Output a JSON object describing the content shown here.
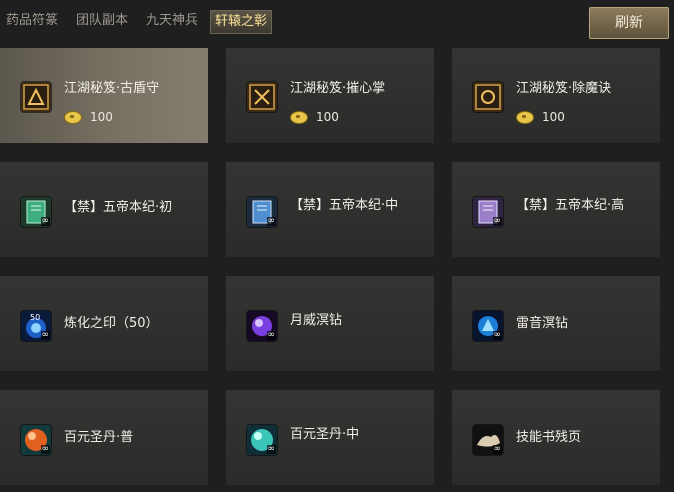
{
  "tabs": [
    {
      "label": "药品符篆",
      "active": false
    },
    {
      "label": "团队副本",
      "active": false
    },
    {
      "label": "九天神兵",
      "active": false
    },
    {
      "label": "轩辕之彰",
      "active": true
    }
  ],
  "refresh_label": "刷新",
  "currency_icon": "gold-coin-icon",
  "items": [
    {
      "name": "江湖秘笈·古盾守",
      "price": "100",
      "icon": "secret-manual-icon",
      "selected": true
    },
    {
      "name": "江湖秘笈·摧心掌",
      "price": "100",
      "icon": "secret-manual-icon",
      "selected": false
    },
    {
      "name": "江湖秘笈·除魔诀",
      "price": "100",
      "icon": "secret-manual-icon",
      "selected": false
    },
    {
      "name": "【禁】五帝本纪·初",
      "price": "",
      "icon": "green-book-icon",
      "badge": "∞",
      "selected": false
    },
    {
      "name": "【禁】五帝本纪·中",
      "price": "",
      "icon": "blue-book-icon",
      "badge": "∞",
      "selected": false
    },
    {
      "name": "【禁】五帝本纪·高",
      "price": "",
      "icon": "purple-book-icon",
      "badge": "∞",
      "selected": false
    },
    {
      "name": "炼化之印（50）",
      "price": "",
      "icon": "refine-seal-icon",
      "badge": "∞",
      "icon_text": "50",
      "selected": false
    },
    {
      "name": "月威溟钻",
      "price": "",
      "icon": "purple-gem-icon",
      "badge": "∞",
      "selected": false
    },
    {
      "name": "雷音溟钻",
      "price": "",
      "icon": "blue-gem-icon",
      "badge": "∞",
      "selected": false
    },
    {
      "name": "百元圣丹·普",
      "price": "",
      "icon": "orange-pill-icon",
      "badge": "∞",
      "selected": false
    },
    {
      "name": "百元圣丹·中",
      "price": "",
      "icon": "teal-pill-icon",
      "badge": "∞",
      "selected": false
    },
    {
      "name": "技能书残页",
      "price": "",
      "icon": "scroll-fragment-icon",
      "badge": "∞",
      "selected": false
    }
  ]
}
